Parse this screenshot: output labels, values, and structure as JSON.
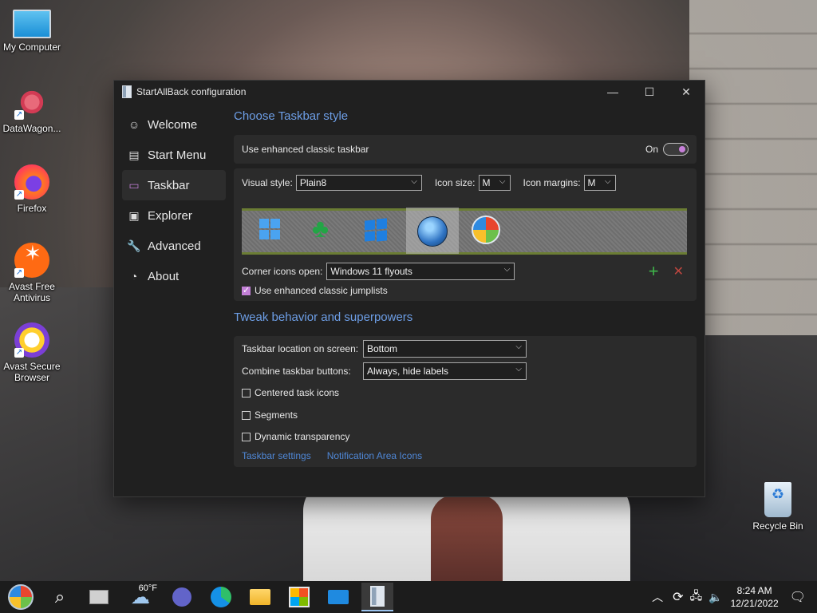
{
  "desktop": {
    "icons": [
      {
        "label": "My Computer"
      },
      {
        "label": "DataWagon..."
      },
      {
        "label": "Firefox"
      },
      {
        "label": "Avast Free Antivirus"
      },
      {
        "label": "Avast Secure Browser"
      },
      {
        "label": "Recycle Bin"
      }
    ]
  },
  "window": {
    "title": "StartAllBack configuration",
    "controls": {
      "minimize": "—",
      "maximize": "☐",
      "close": "✕"
    }
  },
  "sidebar": {
    "items": [
      {
        "label": "Welcome",
        "icon": "smiley-icon",
        "glyph": "☺"
      },
      {
        "label": "Start Menu",
        "icon": "start-menu-icon",
        "glyph": "▤"
      },
      {
        "label": "Taskbar",
        "icon": "taskbar-icon",
        "glyph": "▭"
      },
      {
        "label": "Explorer",
        "icon": "folder-icon",
        "glyph": "▣"
      },
      {
        "label": "Advanced",
        "icon": "wrench-icon",
        "glyph": "🔧"
      },
      {
        "label": "About",
        "icon": "gauge-icon",
        "glyph": "◔"
      }
    ]
  },
  "taskbar_section": {
    "title": "Choose Taskbar style",
    "enhanced_label": "Use enhanced classic taskbar",
    "enhanced_state": "On",
    "visual_style_label": "Visual style:",
    "visual_style_value": "Plain8",
    "icon_size_label": "Icon size:",
    "icon_size_value": "M",
    "icon_margins_label": "Icon margins:",
    "icon_margins_value": "M",
    "corner_label": "Corner icons open:",
    "corner_value": "Windows 11 flyouts",
    "jumplists_label": "Use enhanced classic jumplists",
    "add_glyph": "+",
    "remove_glyph": "✕"
  },
  "tweak_section": {
    "title": "Tweak behavior and superpowers",
    "location_label": "Taskbar location on screen:",
    "location_value": "Bottom",
    "combine_label": "Combine taskbar buttons:",
    "combine_value": "Always, hide labels",
    "centered_label": "Centered task icons",
    "segments_label": "Segments",
    "dynamic_label": "Dynamic transparency",
    "link1": "Taskbar settings",
    "link2": "Notification Area Icons"
  },
  "taskbar": {
    "weather": "60°F",
    "time": "8:24 AM",
    "date": "12/21/2022"
  }
}
